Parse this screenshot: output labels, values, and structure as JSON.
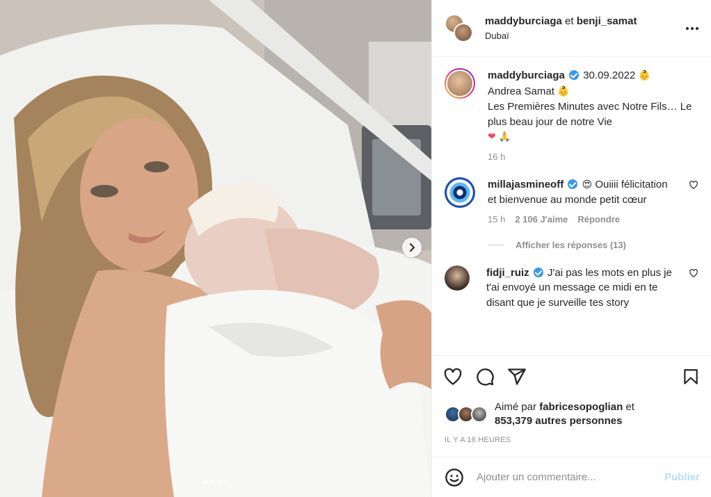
{
  "header": {
    "user1": "maddyburciaga",
    "conjunction": "et",
    "user2": "benji_samat",
    "location": "Dubaï",
    "icons": {
      "more": "more-horizontal-icon"
    }
  },
  "caption": {
    "username": "maddyburciaga",
    "line1_suffix": "30.09.2022",
    "line2": "Andrea Samat",
    "line3": "Les Premières Minutes avec Notre Fils… Le plus beau jour de notre Vie",
    "emoji_baby": "👶",
    "emoji_heart": "❤",
    "emoji_pray": "🙏",
    "time": "16 h"
  },
  "comments": [
    {
      "username": "millajasmineoff",
      "emoji": "😍",
      "text": "Ouiiii félicitation et bienvenue au monde petit cœur",
      "time": "15 h",
      "likes": "2 106 J'aime",
      "reply": "Répondre"
    },
    {
      "username": "fidji_ruiz",
      "text": "J'ai pas les mots en plus je t'ai envoyé un message ce midi en te disant que je surveille tes story"
    }
  ],
  "view_replies": "Afficher les réponses (13)",
  "liked_by": {
    "prefix": "Aimé par",
    "user": "fabricesopoglian",
    "and": "et",
    "others": "853,379 autres personnes"
  },
  "timestamp": "IL Y A 16 HEURES",
  "add_comment": {
    "placeholder": "Ajouter un commentaire...",
    "publish": "Publier"
  },
  "carousel": {
    "slide_count": 4,
    "active_index": 0
  },
  "colors": {
    "accent": "#3897f0",
    "publish_disabled": "#b2dffc",
    "heart": "#ed4956",
    "meta": "#8e8e8e"
  }
}
